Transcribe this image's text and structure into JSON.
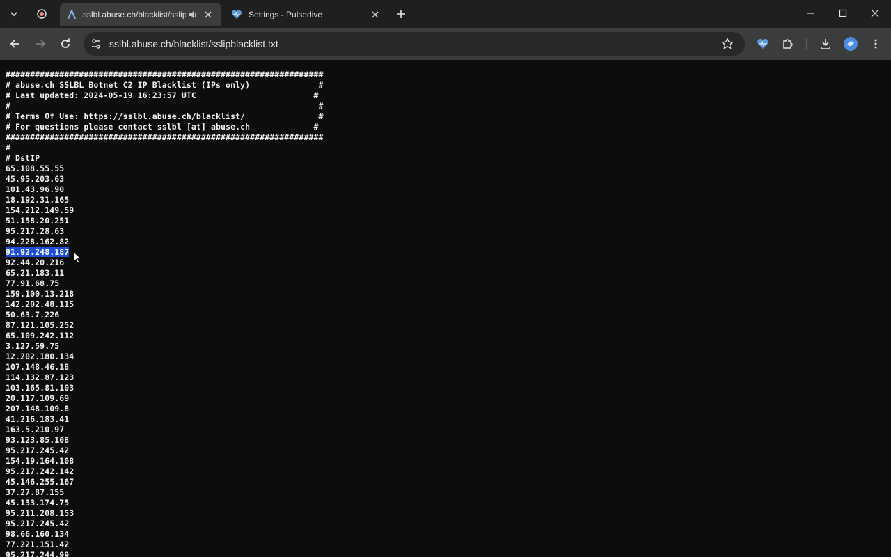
{
  "browser": {
    "tabs": [
      {
        "title": "sslbl.abuse.ch/blacklist/sslip",
        "icon": "abuse-ch-favicon",
        "active": true,
        "audio": true
      },
      {
        "title": "Settings - Pulsedive",
        "icon": "pulsedive-favicon",
        "active": false
      }
    ],
    "url": "sslbl.abuse.ch/blacklist/sslipblacklist.txt"
  },
  "page": {
    "header_lines": [
      "#################################################################",
      "# abuse.ch SSLBL Botnet C2 IP Blacklist (IPs only)              #",
      "# Last updated: 2024-05-19 16:23:57 UTC                        #",
      "#                                                               #",
      "# Terms Of Use: https://sslbl.abuse.ch/blacklist/               #",
      "# For questions please contact sslbl [at] abuse.ch             #",
      "#################################################################",
      "#",
      "# DstIP"
    ],
    "ips": [
      "65.108.55.55",
      "45.95.203.63",
      "101.43.96.90",
      "18.192.31.165",
      "154.212.149.59",
      "51.158.20.251",
      "95.217.28.63",
      "94.228.162.82",
      "91.92.248.187",
      "92.44.20.216",
      "65.21.183.11",
      "77.91.68.75",
      "159.100.13.218",
      "142.202.48.115",
      "50.63.7.226",
      "87.121.105.252",
      "65.109.242.112",
      "3.127.59.75",
      "12.202.180.134",
      "107.148.46.18",
      "114.132.87.123",
      "103.165.81.103",
      "20.117.109.69",
      "207.148.109.8",
      "41.216.183.41",
      "163.5.210.97",
      "93.123.85.108",
      "95.217.245.42",
      "154.19.164.108",
      "95.217.242.142",
      "45.146.255.167",
      "37.27.87.155",
      "45.133.174.75",
      "95.211.208.153",
      "95.217.245.42",
      "98.66.160.134",
      "77.221.151.42",
      "95.217.244.99"
    ],
    "selected_ip_index": 8
  },
  "colors": {
    "selection": "#1a4fd6",
    "background": "#0d0d0d",
    "text": "#f2f2f2"
  }
}
